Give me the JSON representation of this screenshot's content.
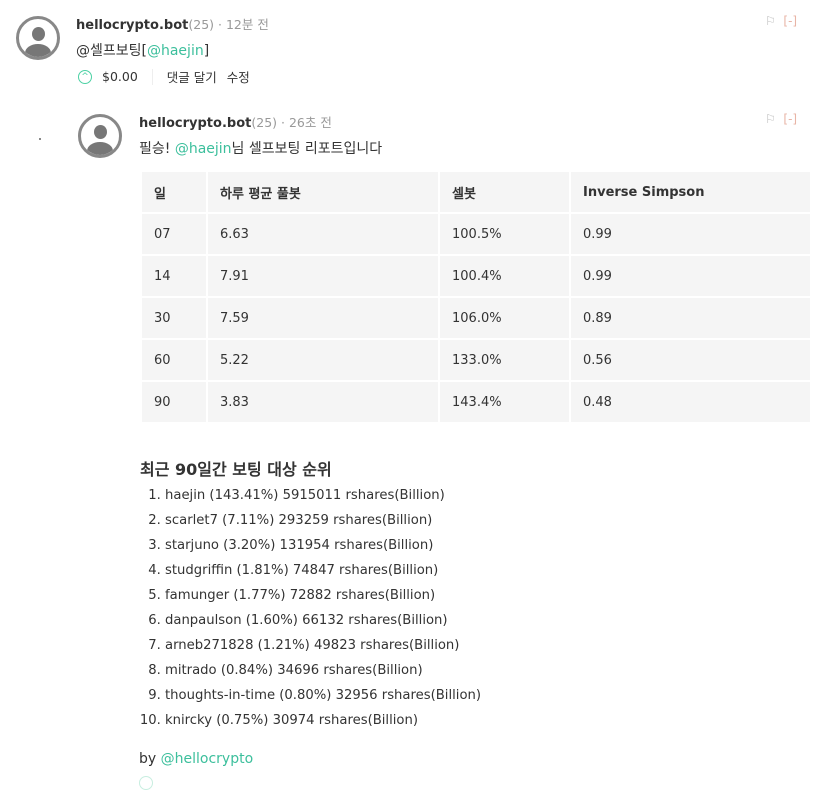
{
  "comment1": {
    "author": "hellocrypto.bot",
    "rep": "(25)",
    "time": "· 12분 전",
    "body_prefix": "@셀프보팅[",
    "mention": "@haejin",
    "body_suffix": "]",
    "payout": "$0.00",
    "reply": "댓글 달기",
    "edit": "수정",
    "flag": "⚐",
    "collapse": "[-]"
  },
  "comment2": {
    "author": "hellocrypto.bot",
    "rep": "(25)",
    "time": "· 26초 전",
    "body_prefix": "필승! ",
    "mention": "@haejin",
    "body_suffix": "님 셀프보팅 리포트입니다",
    "flag": "⚐",
    "collapse": "[-]",
    "table": {
      "headers": [
        "일",
        "하루 평균 풀봇",
        "셀봇",
        "Inverse Simpson"
      ],
      "rows": [
        [
          "07",
          "6.63",
          "100.5%",
          "0.99"
        ],
        [
          "14",
          "7.91",
          "100.4%",
          "0.99"
        ],
        [
          "30",
          "7.59",
          "106.0%",
          "0.89"
        ],
        [
          "60",
          "5.22",
          "133.0%",
          "0.56"
        ],
        [
          "90",
          "3.83",
          "143.4%",
          "0.48"
        ]
      ]
    },
    "ranking_title": "최근 90일간 보팅 대상 순위",
    "ranking": [
      "haejin (143.41%) 5915011 rshares(Billion)",
      "scarlet7 (7.11%) 293259 rshares(Billion)",
      "starjuno (3.20%) 131954 rshares(Billion)",
      "studgriffin (1.81%) 74847 rshares(Billion)",
      "famunger (1.77%) 72882 rshares(Billion)",
      "danpaulson (1.60%) 66132 rshares(Billion)",
      "arneb271828 (1.21%) 49823 rshares(Billion)",
      "mitrado (0.84%) 34696 rshares(Billion)",
      "thoughts-in-time (0.80%) 32956 rshares(Billion)",
      "knircky (0.75%) 30974 rshares(Billion)"
    ],
    "by": "by ",
    "by_user": "@hellocrypto"
  }
}
